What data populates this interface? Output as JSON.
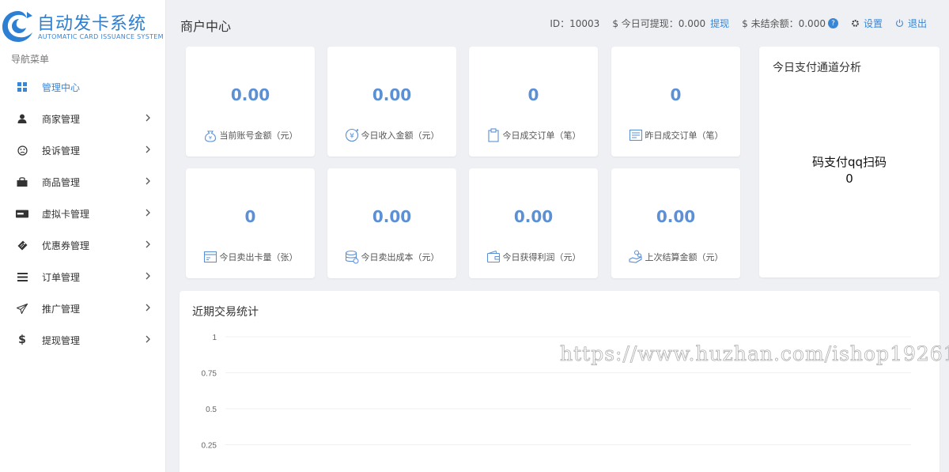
{
  "brand": {
    "title": "自动发卡系统",
    "subtitle": "AUTOMATIC CARD ISSUANCE SYSTEM",
    "color": "#2d7fd3"
  },
  "nav": {
    "title": "导航菜单",
    "items": [
      {
        "label": "管理中心",
        "icon": "dashboard-icon",
        "active": true
      },
      {
        "label": "商家管理",
        "icon": "user-icon"
      },
      {
        "label": "投诉管理",
        "icon": "frown-icon"
      },
      {
        "label": "商品管理",
        "icon": "shopping-bag-icon"
      },
      {
        "label": "虚拟卡管理",
        "icon": "credit-card-icon"
      },
      {
        "label": "优惠券管理",
        "icon": "ticket-icon"
      },
      {
        "label": "订单管理",
        "icon": "list-icon"
      },
      {
        "label": "推广管理",
        "icon": "paper-plane-icon"
      },
      {
        "label": "提现管理",
        "icon": "dollar-icon"
      }
    ]
  },
  "header": {
    "page_title": "商户中心",
    "id_label": "ID：",
    "id_value": "10003",
    "withdrawable_label": "$ 今日可提现：",
    "withdrawable_value": "0.000",
    "withdraw_link": "提现",
    "unsettled_label": "$ 未结余额：",
    "unsettled_value": "0.000",
    "help_mark": "?",
    "settings_label": "设置",
    "logout_label": "退出"
  },
  "stats": [
    {
      "value": "0.00",
      "label": "当前账号金额（元）",
      "icon": "money-bag-icon"
    },
    {
      "value": "0.00",
      "label": "今日收入金额（元）",
      "icon": "yen-coin-icon"
    },
    {
      "value": "0",
      "label": "今日成交订单（笔）",
      "icon": "clipboard-icon"
    },
    {
      "value": "0",
      "label": "昨日成交订单（笔）",
      "icon": "document-icon"
    },
    {
      "value": "0",
      "label": "今日卖出卡量（张）",
      "icon": "card-window-icon"
    },
    {
      "value": "0.00",
      "label": "今日卖出成本（元）",
      "icon": "coin-stack-icon"
    },
    {
      "value": "0.00",
      "label": "今日获得利润（元）",
      "icon": "wallet-icon"
    },
    {
      "value": "0.00",
      "label": "上次结算金额（元）",
      "icon": "hand-coins-icon"
    }
  ],
  "channel_panel": {
    "title": "今日支付通道分析",
    "channel_name": "码支付qq扫码",
    "channel_value": "0"
  },
  "trade_panel": {
    "title": "近期交易统计"
  },
  "chart_data": {
    "type": "line",
    "title": "近期交易统计",
    "xlabel": "",
    "ylabel": "",
    "ylim": [
      0,
      1
    ],
    "yticks": [
      "1",
      "0.75",
      "0.5",
      "0.25"
    ],
    "grid": true,
    "series": []
  },
  "watermark": "https://www.huzhan.com/ishop19261",
  "colors": {
    "accent": "#3a86d6",
    "stat_value": "#5b8fd6",
    "background": "#eef0f4"
  }
}
